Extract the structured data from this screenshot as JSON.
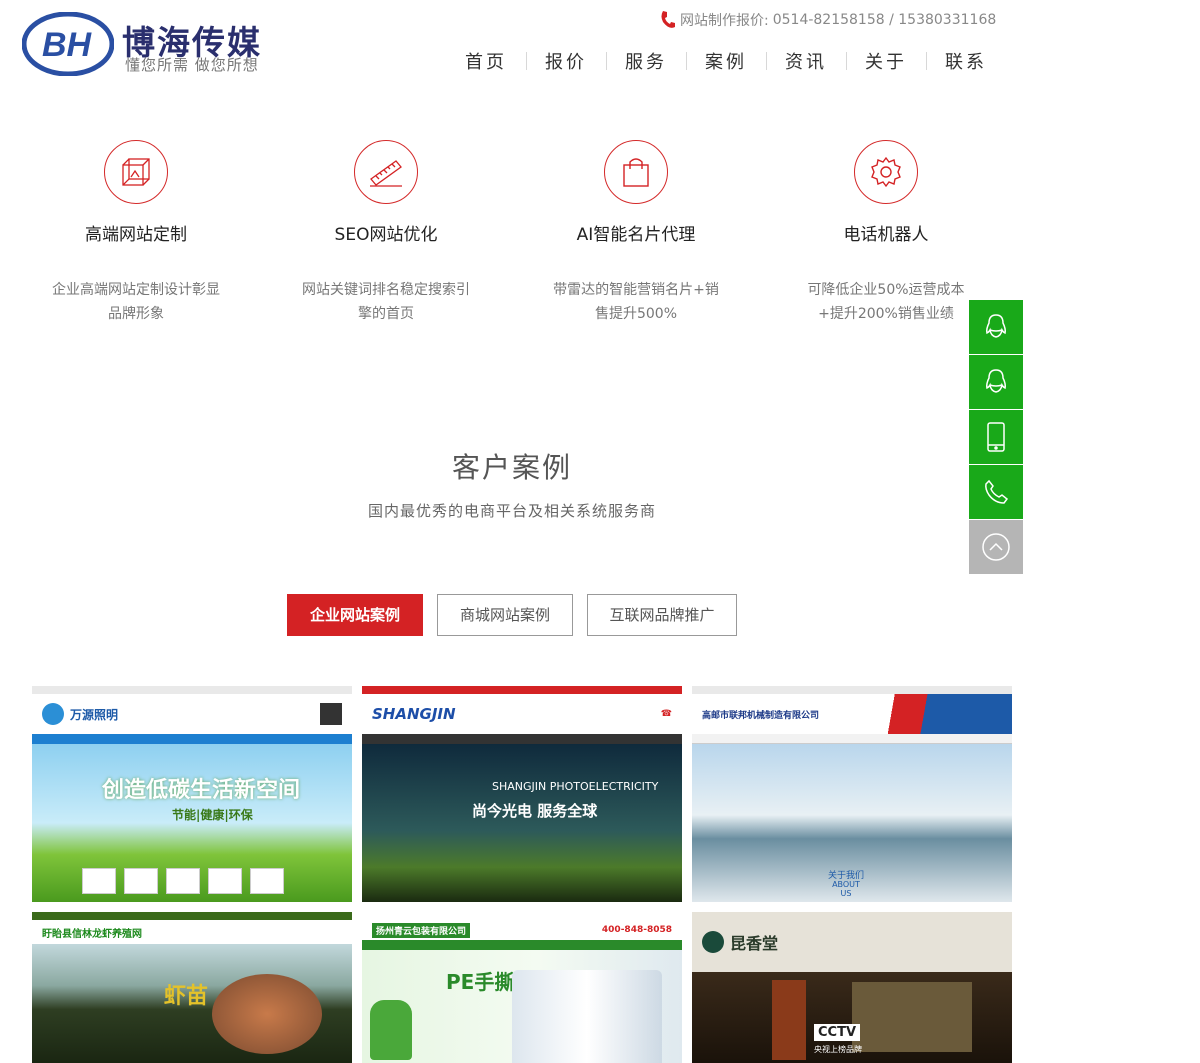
{
  "brand": {
    "mark": "BH",
    "name": "博海传媒",
    "slogan": "懂您所需 做您所想"
  },
  "contact": {
    "label": "网站制作报价:",
    "phones": "0514-82158158 / 15380331168"
  },
  "nav": [
    "首页",
    "报价",
    "服务",
    "案例",
    "资讯",
    "关于",
    "联系"
  ],
  "services": [
    {
      "icon": "cube-frame-icon",
      "title": "高端网站定制",
      "desc": "企业高端网站定制设计彰显品牌形象"
    },
    {
      "icon": "ruler-icon",
      "title": "SEO网站优化",
      "desc": "网站关键词排名稳定搜索引擎的首页"
    },
    {
      "icon": "shopping-bag-icon",
      "title": "AI智能名片代理",
      "desc": "带雷达的智能营销名片+销售提升500%"
    },
    {
      "icon": "gear-icon",
      "title": "电话机器人",
      "desc": "可降低企业50%运营成本+提升200%销售业绩"
    }
  ],
  "cases": {
    "title": "客户案例",
    "subtitle": "国内最优秀的电商平台及相关系统服务商",
    "tabs": [
      "企业网站案例",
      "商城网站案例",
      "互联网品牌推广"
    ],
    "items": [
      {
        "name": "万源照明",
        "banner": "创造低碳生活新空间",
        "tagline": "节能|健康|环保"
      },
      {
        "name": "SHANGJIN",
        "banner": "尚今光电 服务全球",
        "tagline": "SHANGJIN PHOTOELECTRICITY"
      },
      {
        "name": "高邮市联邦机械制造有限公司",
        "banner": "关于我们",
        "tagline": "ABOUT US"
      },
      {
        "name": "盱眙县信林龙虾养殖网",
        "banner": "虾苗",
        "tagline": ""
      },
      {
        "name": "扬州青云包装有限公司",
        "banner": "PE手撕袋",
        "tagline": "400-848-8058"
      },
      {
        "name": "昆香堂",
        "banner": "CCTV",
        "tagline": "央视上榜品牌"
      }
    ]
  },
  "sidebar": [
    "qq-icon",
    "qq-icon",
    "mobile-icon",
    "phone-icon",
    "back-to-top-icon"
  ],
  "colors": {
    "accent": "#d42224",
    "brand": "#2a2f6e",
    "sidebar": "#19a919"
  }
}
